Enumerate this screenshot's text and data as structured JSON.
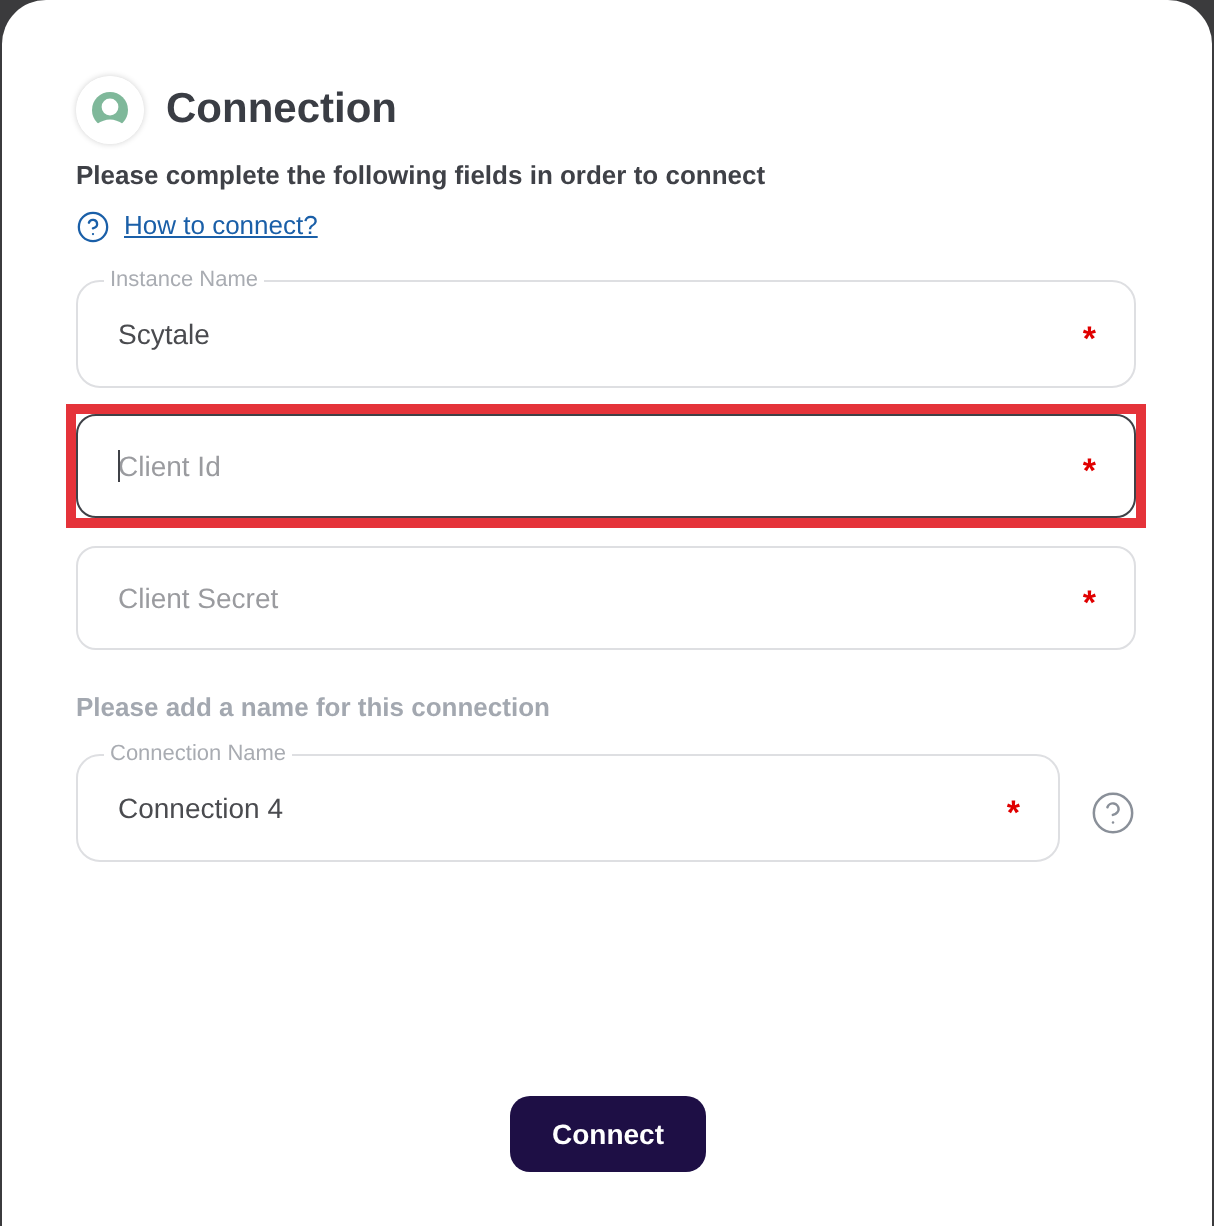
{
  "dialog": {
    "title": "Connection",
    "subtitle": "Please complete the following fields in order to connect",
    "help_link": "How to connect?"
  },
  "fields": [
    {
      "label": "Instance Name",
      "value": "Scytale",
      "required_mark": "*",
      "focused": false,
      "highlighted": false
    },
    {
      "placeholder": "Client Id",
      "required_mark": "*",
      "focused": true,
      "highlighted": true
    },
    {
      "placeholder": "Client Secret",
      "required_mark": "*",
      "focused": false,
      "highlighted": false
    }
  ],
  "name_section": {
    "hint": "Please add a name for this connection",
    "field": {
      "label": "Connection Name",
      "value": "Connection 4",
      "required_mark": "*",
      "focused": false,
      "highlighted": false
    }
  },
  "buttons": [
    {
      "label": "Connect"
    }
  ]
}
